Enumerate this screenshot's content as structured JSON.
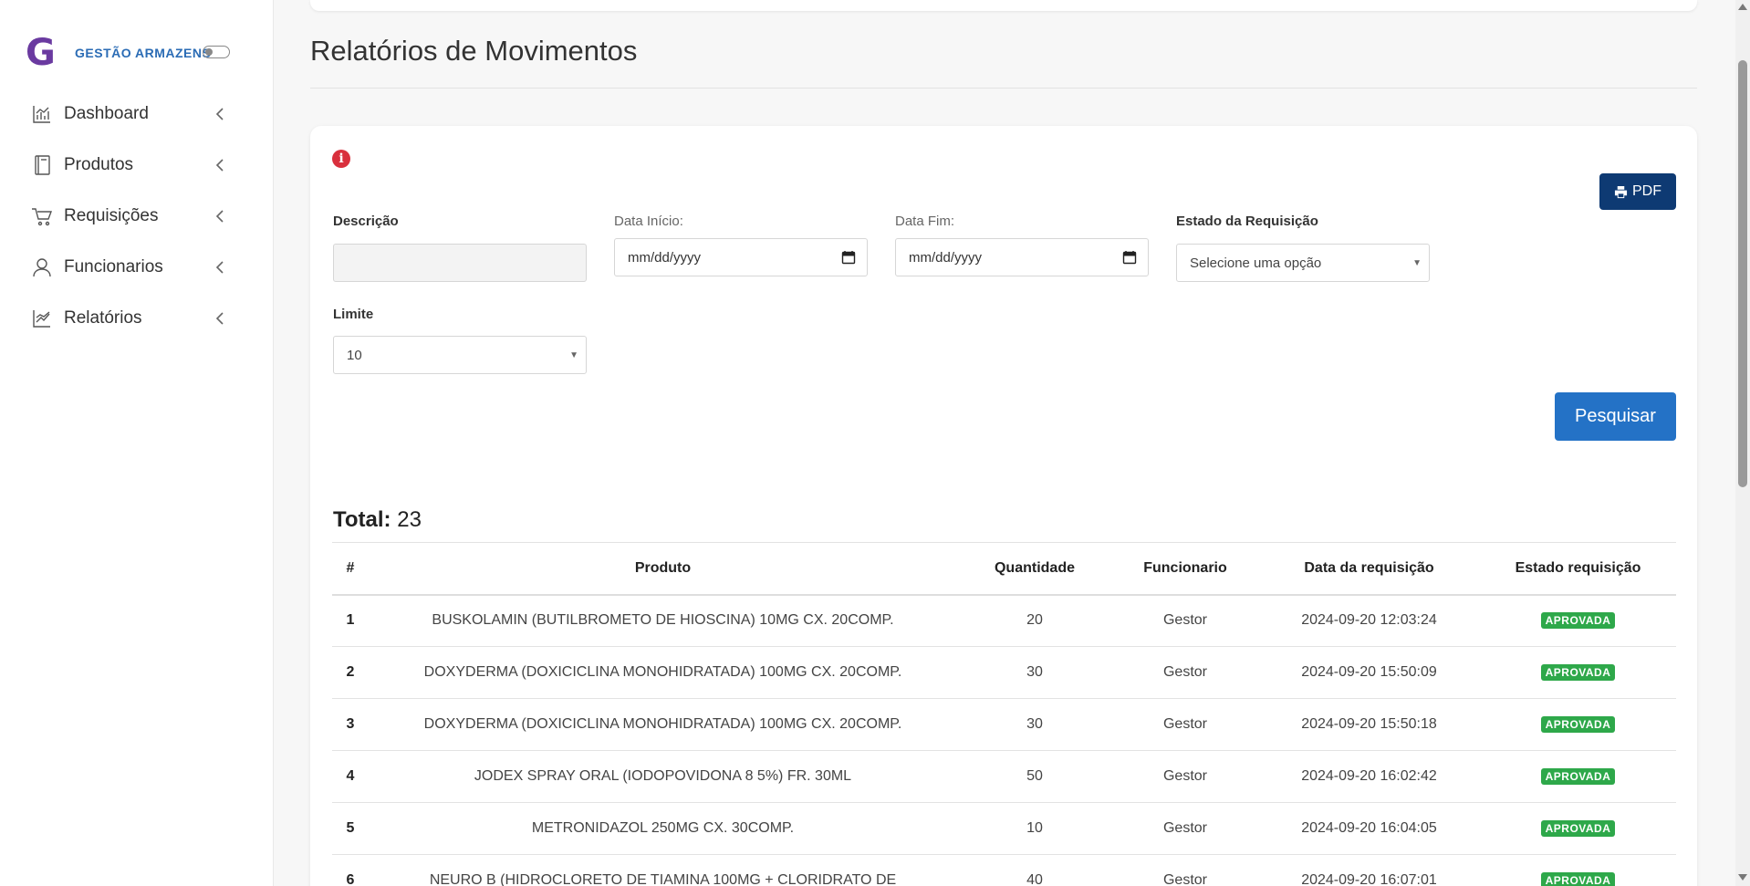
{
  "brand": {
    "logo": "G",
    "name": "GESTÃO ARMAZENS",
    "toggle_icon": "toggle-icon"
  },
  "sidebar": {
    "items": [
      {
        "label": "Dashboard",
        "icon": "chart-icon"
      },
      {
        "label": "Produtos",
        "icon": "book-icon"
      },
      {
        "label": "Requisições",
        "icon": "cart-icon"
      },
      {
        "label": "Funcionarios",
        "icon": "user-icon"
      },
      {
        "label": "Relatórios",
        "icon": "report-icon"
      }
    ]
  },
  "page": {
    "title": "Relatórios de Movimentos"
  },
  "toolbar": {
    "pdf_label": "PDF"
  },
  "filters": {
    "descricao_label": "Descrição",
    "descricao_value": "",
    "data_inicio_label": "Data Início:",
    "data_inicio_placeholder": "mm/dd/yyyy",
    "data_fim_label": "Data Fim:",
    "data_fim_placeholder": "mm/dd/yyyy",
    "estado_label": "Estado da Requisição",
    "estado_value": "Selecione uma opção",
    "limite_label": "Limite",
    "limite_value": "10",
    "search_label": "Pesquisar"
  },
  "results": {
    "total_label": "Total:",
    "total_value": "23"
  },
  "table": {
    "headers": [
      "#",
      "Produto",
      "Quantidade",
      "Funcionario",
      "Data da requisição",
      "Estado requisição"
    ],
    "rows": [
      {
        "n": "1",
        "produto": "BUSKOLAMIN (BUTILBROMETO DE HIOSCINA) 10MG CX. 20COMP.",
        "quantidade": "20",
        "funcionario": "Gestor",
        "data": "2024-09-20 12:03:24",
        "estado": "APROVADA"
      },
      {
        "n": "2",
        "produto": "DOXYDERMA (DOXICICLINA MONOHIDRATADA) 100MG CX. 20COMP.",
        "quantidade": "30",
        "funcionario": "Gestor",
        "data": "2024-09-20 15:50:09",
        "estado": "APROVADA"
      },
      {
        "n": "3",
        "produto": "DOXYDERMA (DOXICICLINA MONOHIDRATADA) 100MG CX. 20COMP.",
        "quantidade": "30",
        "funcionario": "Gestor",
        "data": "2024-09-20 15:50:18",
        "estado": "APROVADA"
      },
      {
        "n": "4",
        "produto": "JODEX SPRAY ORAL (IODOPOVIDONA 8 5%) FR. 30ML",
        "quantidade": "50",
        "funcionario": "Gestor",
        "data": "2024-09-20 16:02:42",
        "estado": "APROVADA"
      },
      {
        "n": "5",
        "produto": "METRONIDAZOL 250MG CX. 30COMP.",
        "quantidade": "10",
        "funcionario": "Gestor",
        "data": "2024-09-20 16:04:05",
        "estado": "APROVADA"
      },
      {
        "n": "6",
        "produto": "NEURO B (HIDROCLORETO DE TIAMINA 100MG + CLORIDRATO DE",
        "quantidade": "40",
        "funcionario": "Gestor",
        "data": "2024-09-20 16:07:01",
        "estado": "APROVADA"
      }
    ]
  },
  "colors": {
    "brand": "#6a3aa0",
    "brand_text": "#2b6cb5",
    "pdf_button": "#0e3a73",
    "search_button": "#2472c6",
    "badge": "#2ea84a",
    "info": "#d9303d"
  }
}
